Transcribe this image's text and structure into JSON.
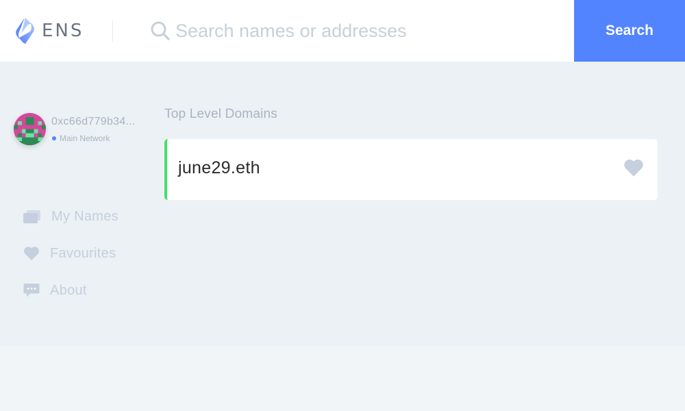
{
  "header": {
    "logo_text": "ENS",
    "search_placeholder": "Search names or addresses",
    "search_value": "",
    "search_button_label": "Search"
  },
  "account": {
    "address": "0xc66d779b34...",
    "network": "Main Network"
  },
  "sidebar": {
    "items": [
      {
        "label": "My Names",
        "icon": "stacked-cards-icon"
      },
      {
        "label": "Favourites",
        "icon": "heart-icon"
      },
      {
        "label": "About",
        "icon": "speech-bubble-icon"
      }
    ]
  },
  "main": {
    "section_title": "Top Level Domains",
    "domains": [
      {
        "name": "june29.eth",
        "favourited": false
      }
    ]
  },
  "colors": {
    "accent": "#5284ff",
    "domain_highlight": "#42e068",
    "muted_text": "#aab3c2",
    "nav_text": "#c5cfdd"
  }
}
